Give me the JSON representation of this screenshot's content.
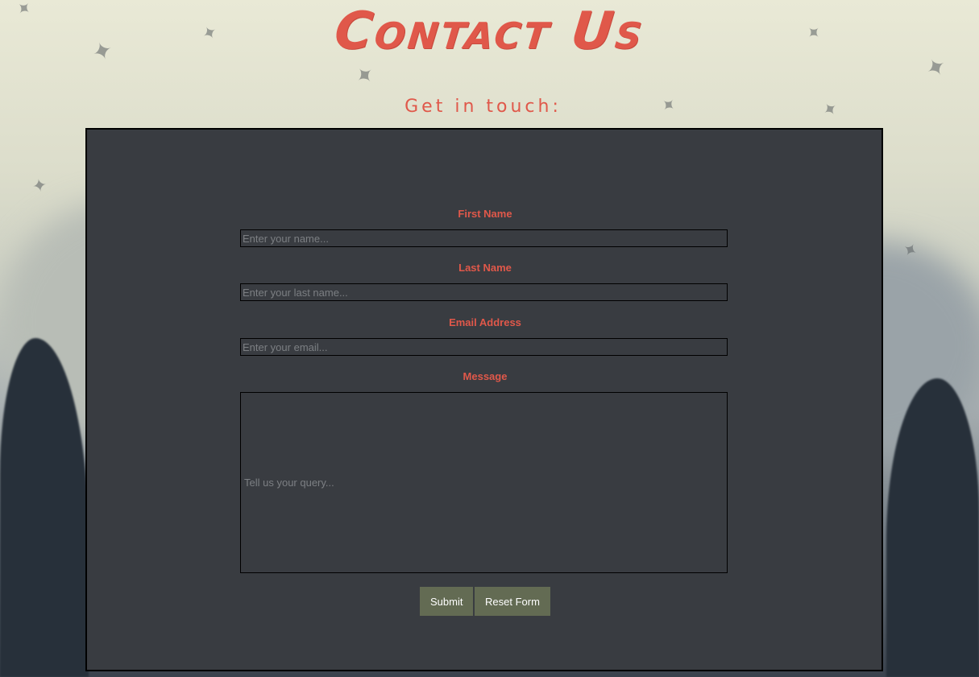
{
  "page": {
    "title": "Contact Us",
    "subtitle": "Get in touch:"
  },
  "form": {
    "first_name": {
      "label": "First Name",
      "placeholder": "Enter your name..."
    },
    "last_name": {
      "label": "Last Name",
      "placeholder": "Enter your last name..."
    },
    "email": {
      "label": "Email Address",
      "placeholder": "Enter your email..."
    },
    "message": {
      "label": "Message",
      "placeholder": "Tell us your query..."
    },
    "submit_label": "Submit",
    "reset_label": "Reset Form"
  },
  "colors": {
    "accent": "#e0584a",
    "panel_bg": "#393c41",
    "button_bg": "#636b53"
  }
}
